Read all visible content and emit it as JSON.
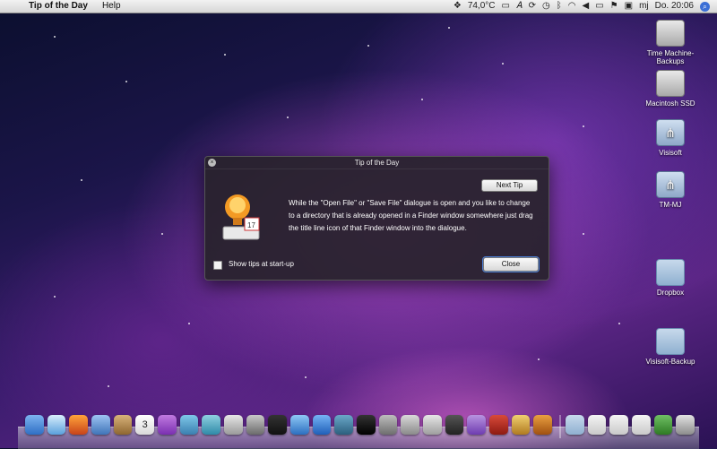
{
  "menubar": {
    "apple": "",
    "app_name": "Tip of the Day",
    "menus": [
      "Help"
    ],
    "status": {
      "temperature": "74,0°C",
      "user": "mj",
      "clock": "Do. 20:06"
    }
  },
  "desktop_icons": [
    {
      "label": "Time Machine-Backups",
      "kind": "drive"
    },
    {
      "label": "Macintosh SSD",
      "kind": "drive"
    },
    {
      "label": "Visisoft",
      "kind": "network-drive"
    },
    {
      "label": "TM-MJ",
      "kind": "network-drive"
    },
    {
      "label": "Dropbox",
      "kind": "folder"
    },
    {
      "label": "Visisoft-Backup",
      "kind": "folder"
    }
  ],
  "dialog": {
    "title": "Tip of the Day",
    "next_tip_label": "Next Tip",
    "tip_text": "While the \"Open File\" or \"Save File\" dialogue is open and you like to change to a directory that is already opened in a Finder window somewhere just drag the title line icon of that Finder window into the dialogue.",
    "checkbox_label": "Show tips at start-up",
    "checkbox_checked": false,
    "close_label": "Close"
  },
  "dock": {
    "apps": [
      "finder-icon",
      "safari-icon",
      "firefox-icon",
      "mail-icon",
      "address-book-icon",
      "ical-icon",
      "folder-app-icon",
      "app-icon",
      "system-icon",
      "preview-icon",
      "camera-icon",
      "itunes-icon",
      "app-store-icon",
      "time-machine-icon",
      "terminal-icon",
      "system-preferences-icon",
      "dashboard-icon",
      "app-icon",
      "mail-icon",
      "app-icon",
      "acrobat-icon",
      "app-icon",
      "app-icon"
    ],
    "ical_day": "3",
    "badges": {
      "mail": "1"
    }
  },
  "colors": {
    "accent": "#4b7fd6",
    "dialog_bg": "#28222c"
  }
}
